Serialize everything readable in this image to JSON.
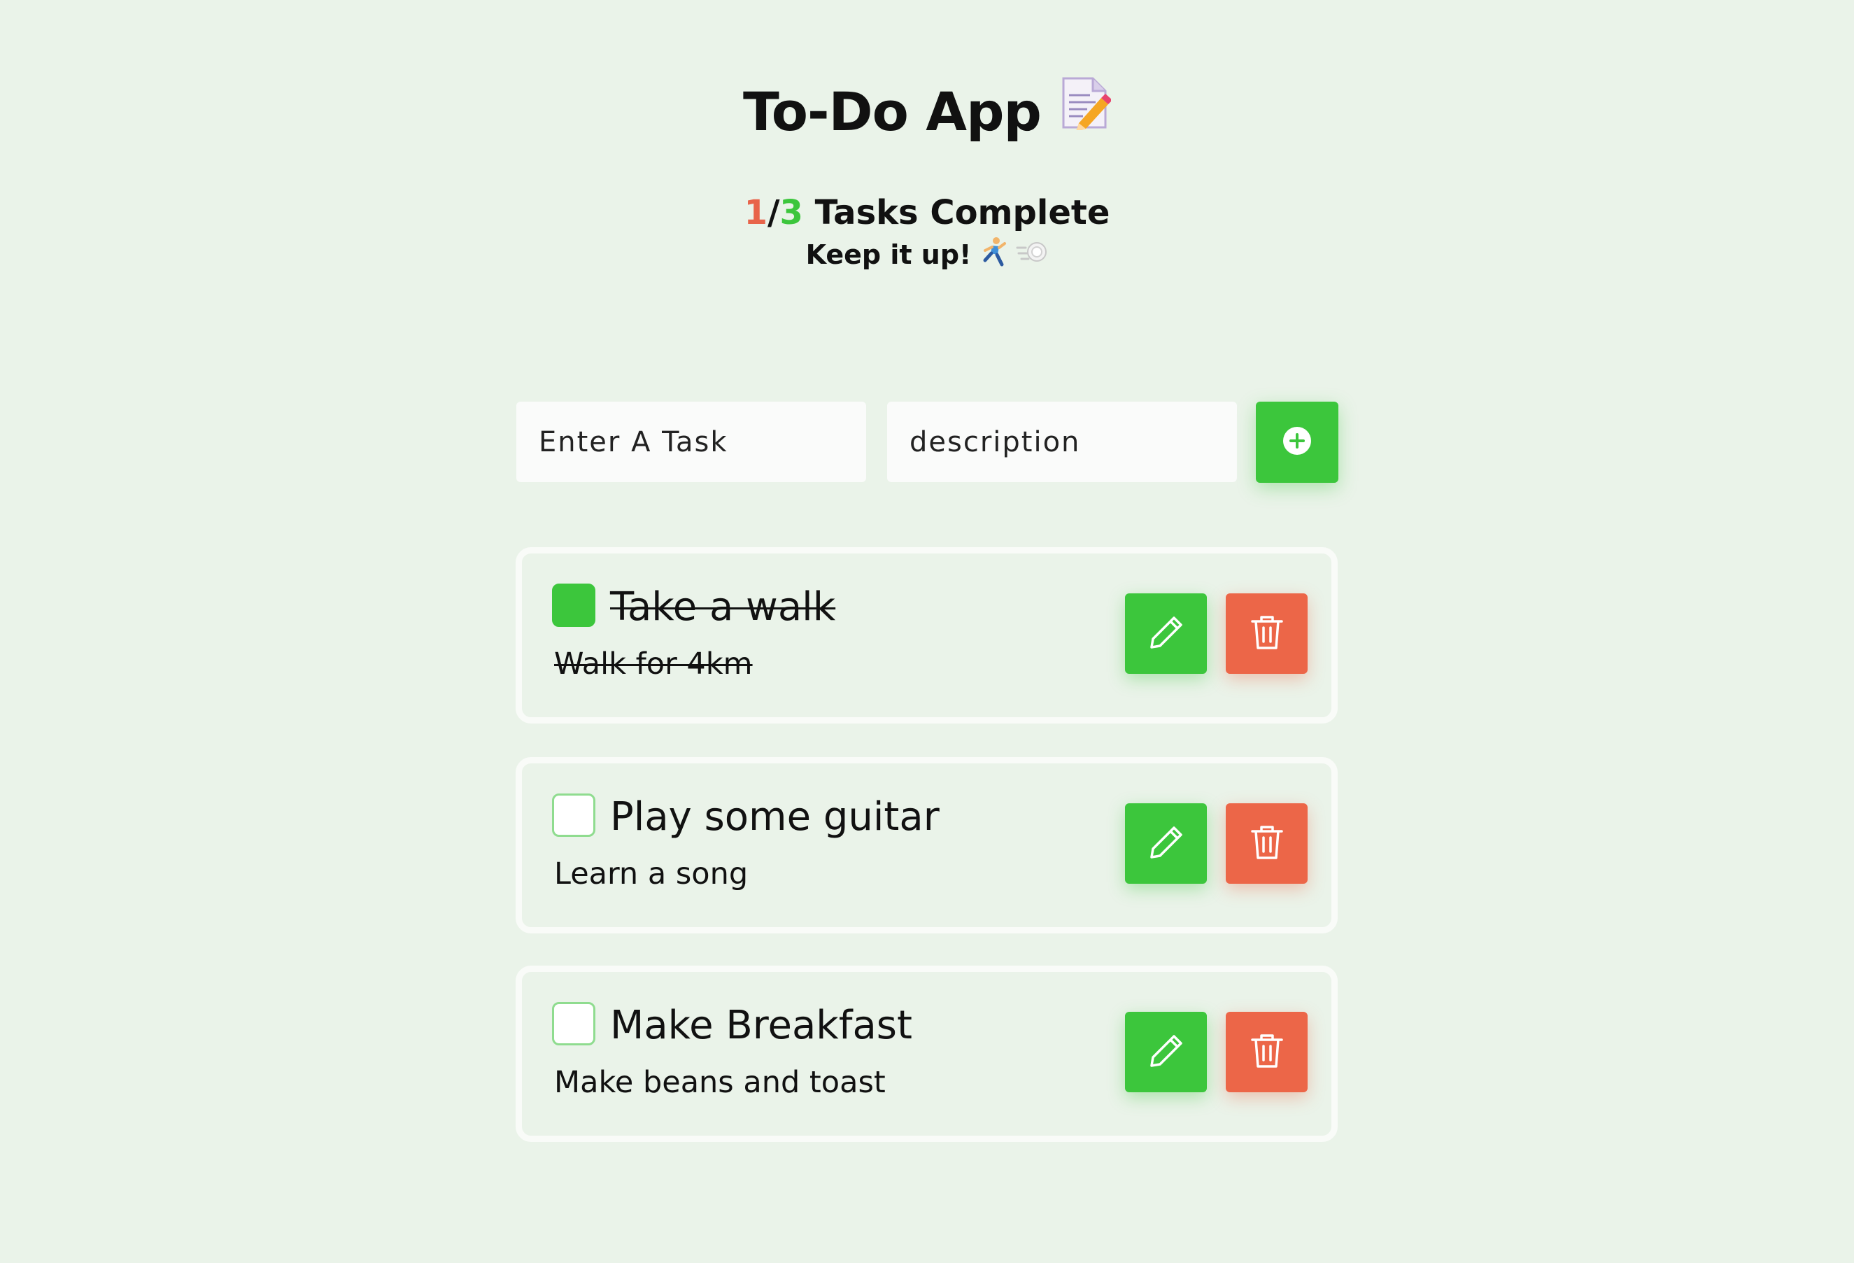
{
  "app": {
    "title": "To-Do App",
    "title_icon": "memo-emoji"
  },
  "progress": {
    "completed": "1",
    "separator": "/",
    "total": "3",
    "label": " Tasks Complete",
    "encouragement": "Keep it up!",
    "encouragement_icons": [
      "runner-emoji",
      "dash-emoji"
    ]
  },
  "form": {
    "task_placeholder": "Enter A Task",
    "description_placeholder": "description",
    "add_button_icon": "plus-circle-icon"
  },
  "tasks": [
    {
      "title": "Take a walk",
      "description": "Walk for 4km",
      "completed": true
    },
    {
      "title": "Play some guitar",
      "description": "Learn a song",
      "completed": false
    },
    {
      "title": "Make Breakfast",
      "description": "Make beans and toast",
      "completed": false
    }
  ],
  "colors": {
    "background": "#eaf3e9",
    "accent_green": "#3cc63c",
    "danger_red": "#ec6648",
    "completed_count": "#e8644a",
    "total_count": "#3cc63c"
  }
}
